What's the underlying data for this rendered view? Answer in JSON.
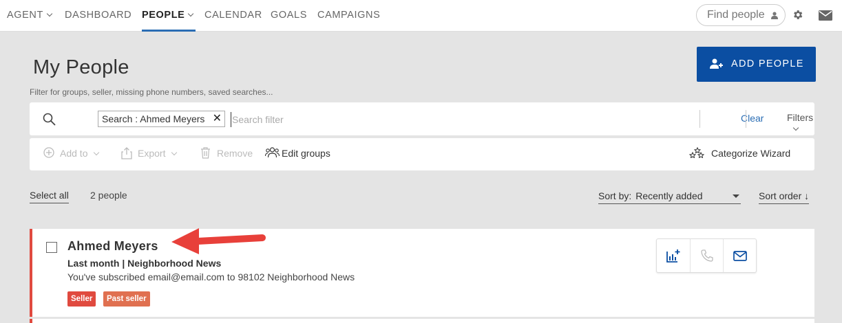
{
  "nav": {
    "items": [
      {
        "label": "AGENT",
        "dropdown": true
      },
      {
        "label": "DASHBOARD",
        "dropdown": false
      },
      {
        "label": "PEOPLE",
        "dropdown": true,
        "active": true
      },
      {
        "label": "CALENDAR",
        "dropdown": false
      },
      {
        "label": "GOALS",
        "dropdown": false
      },
      {
        "label": "CAMPAIGNS",
        "dropdown": false
      }
    ],
    "find_people_placeholder": "Find people",
    "icons": [
      "person-icon",
      "gear-icon",
      "mail-icon"
    ]
  },
  "page": {
    "title": "My People",
    "subtitle": "Filter for groups, seller, missing phone numbers, saved searches...",
    "add_button": "ADD PEOPLE"
  },
  "search": {
    "chip_label": "Search : Ahmed Meyers",
    "chip_close": "✕",
    "placeholder": "Search filter",
    "clear_label": "Clear",
    "filters_label": "Filters"
  },
  "toolbar": {
    "add_to": "Add to",
    "export": "Export",
    "remove": "Remove",
    "edit_groups": "Edit groups",
    "categorize": "Categorize Wizard"
  },
  "list": {
    "select_all": "Select all",
    "count": "2 people",
    "sort_by_label": "Sort by:",
    "sort_by_value": "Recently added",
    "sort_order": "Sort order ↓"
  },
  "people": [
    {
      "name": "Ahmed Meyers",
      "meta": "Last month | Neighborhood News",
      "description": "You've subscribed email@email.com to 98102 Neighborhood News",
      "tags": [
        "Seller",
        "Past seller"
      ]
    }
  ],
  "colors": {
    "accent": "#0b4ea2",
    "link": "#2a6db4",
    "seller_tag": "#e04a3f",
    "past_seller_tag": "#e07050",
    "annotation_arrow": "#e8403a"
  }
}
